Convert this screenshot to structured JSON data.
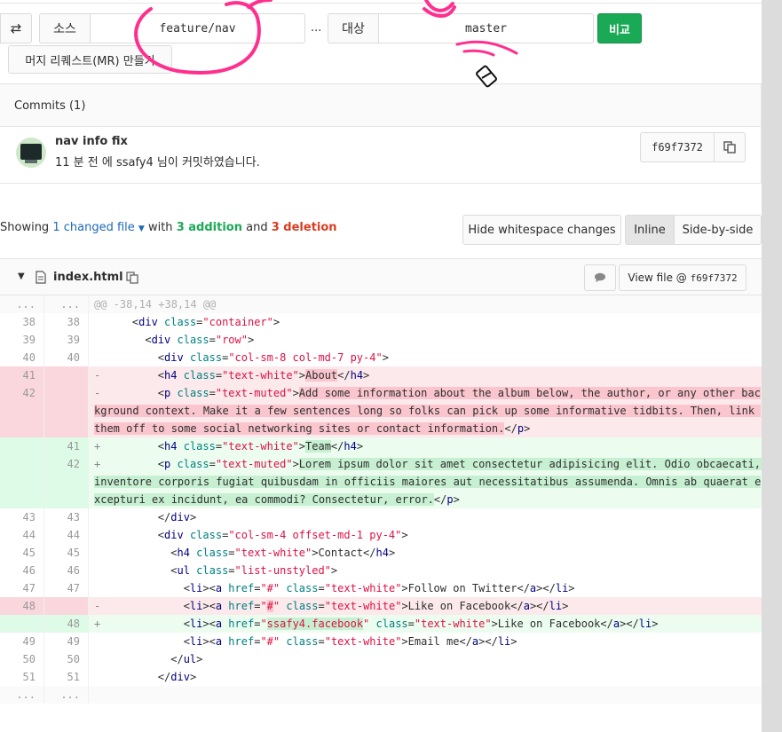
{
  "compare_bar": {
    "swap_icon": "swap-arrows-icon",
    "source_label": "소스",
    "source_branch": "feature/nav",
    "separator": "...",
    "target_label": "대상",
    "target_branch": "master",
    "compare_button": "비교",
    "create_mr_button": "머지 리퀘스트(MR) 만들기"
  },
  "commits": {
    "header": "Commits (1)",
    "items": [
      {
        "title": "nav info fix",
        "meta": "11 분 전 에 ssafy4 님이 커밋하였습니다.",
        "sha": "f69f7372"
      }
    ]
  },
  "summary": {
    "prefix": "Showing",
    "changed": "1 changed file",
    "with": "with",
    "additions": "3 addition",
    "and": "and",
    "deletions": "3 deletion",
    "hide_whitespace": "Hide whitespace changes",
    "inline": "Inline",
    "side_by_side": "Side-by-side"
  },
  "file": {
    "name": "index.html",
    "view_file": "View file @",
    "view_sha": "f69f7372",
    "hunk_header": "@@ -38,14 +38,14 @@"
  },
  "diff_rows": [
    {
      "type": "match",
      "old": "...",
      "new": "...",
      "html": "<span style=\"color:#b0b0b0\">@@ -38,14 +38,14 @@</span>"
    },
    {
      "type": "ctx",
      "old": "38",
      "new": "38",
      "html": "    &lt;<span class=\"tag\">div</span> <span class=\"attr\">class</span>=<span class=\"val\">\"container\"</span>&gt;"
    },
    {
      "type": "ctx",
      "old": "39",
      "new": "39",
      "html": "      &lt;<span class=\"tag\">div</span> <span class=\"attr\">class</span>=<span class=\"val\">\"row\"</span>&gt;"
    },
    {
      "type": "ctx",
      "old": "40",
      "new": "40",
      "html": "        &lt;<span class=\"tag\">div</span> <span class=\"attr\">class</span>=<span class=\"val\">\"col-sm-8 col-md-7 py-4\"</span>&gt;"
    },
    {
      "type": "old",
      "old": "41",
      "new": "",
      "html": "<span class=\"sign\">-</span>        &lt;<span class=\"tag\">h4</span> <span class=\"attr\">class</span>=<span class=\"val\">\"text-white\"</span>&gt;<span class=\"hl-old\">About</span>&lt;/<span class=\"tag\">h4</span>&gt;"
    },
    {
      "type": "old",
      "tall": true,
      "old": "42",
      "new": "",
      "html": "<span class=\"sign\">-</span>        &lt;<span class=\"tag\">p</span> <span class=\"attr\">class</span>=<span class=\"val\">\"text-muted\"</span>&gt;<span class=\"hl-old\">Add some information about the album below, the author, or any other background context. Make it a few sentences long so folks can pick up some informative tidbits. Then, link them off to some social networking sites or contact information.</span>&lt;/<span class=\"tag\">p</span>&gt;"
    },
    {
      "type": "new",
      "old": "",
      "new": "41",
      "html": "<span class=\"sign\">+</span>        &lt;<span class=\"tag\">h4</span> <span class=\"attr\">class</span>=<span class=\"val\">\"text-white\"</span>&gt;<span class=\"hl-new\">Team</span>&lt;/<span class=\"tag\">h4</span>&gt;"
    },
    {
      "type": "new",
      "tall": true,
      "old": "",
      "new": "42",
      "html": "<span class=\"sign\">+</span>        &lt;<span class=\"tag\">p</span> <span class=\"attr\">class</span>=<span class=\"val\">\"text-muted\"</span>&gt;<span class=\"hl-new\">Lorem ipsum dolor sit amet consectetur adipisicing elit. Odio obcaecati, inventore corporis fugiat quibusdam in officiis maiores aut necessitatibus assumenda. Omnis ab quaerat excepturi ex incidunt, ea commodi? Consectetur, error.</span>&lt;/<span class=\"tag\">p</span>&gt;"
    },
    {
      "type": "ctx",
      "old": "43",
      "new": "43",
      "html": "        &lt;/<span class=\"tag\">div</span>&gt;"
    },
    {
      "type": "ctx",
      "old": "44",
      "new": "44",
      "html": "        &lt;<span class=\"tag\">div</span> <span class=\"attr\">class</span>=<span class=\"val\">\"col-sm-4 offset-md-1 py-4\"</span>&gt;"
    },
    {
      "type": "ctx",
      "old": "45",
      "new": "45",
      "html": "          &lt;<span class=\"tag\">h4</span> <span class=\"attr\">class</span>=<span class=\"val\">\"text-white\"</span>&gt;Contact&lt;/<span class=\"tag\">h4</span>&gt;"
    },
    {
      "type": "ctx",
      "old": "46",
      "new": "46",
      "html": "          &lt;<span class=\"tag\">ul</span> <span class=\"attr\">class</span>=<span class=\"val\">\"list-unstyled\"</span>&gt;"
    },
    {
      "type": "ctx",
      "old": "47",
      "new": "47",
      "html": "            &lt;<span class=\"tag\">li</span>&gt;&lt;<span class=\"tag\">a</span> <span class=\"attr\">href</span>=<span class=\"val\">\"#\"</span> <span class=\"attr\">class</span>=<span class=\"val\">\"text-white\"</span>&gt;Follow on Twitter&lt;/<span class=\"tag\">a</span>&gt;&lt;/<span class=\"tag\">li</span>&gt;"
    },
    {
      "type": "old",
      "old": "48",
      "new": "",
      "html": "<span class=\"sign\">-</span>            &lt;<span class=\"tag\">li</span>&gt;&lt;<span class=\"tag\">a</span> <span class=\"attr\">href</span>=<span class=\"val\">\"<span class=\"hl-old\">#</span>\"</span> <span class=\"attr\">class</span>=<span class=\"val\">\"text-white\"</span>&gt;Like on Facebook&lt;/<span class=\"tag\">a</span>&gt;&lt;/<span class=\"tag\">li</span>&gt;"
    },
    {
      "type": "new",
      "old": "",
      "new": "48",
      "html": "<span class=\"sign\">+</span>            &lt;<span class=\"tag\">li</span>&gt;&lt;<span class=\"tag\">a</span> <span class=\"attr\">href</span>=<span class=\"val\">\"<span class=\"hl-new\">ssafy4.facebook</span>\"</span> <span class=\"attr\">class</span>=<span class=\"val\">\"text-white\"</span>&gt;Like on Facebook&lt;/<span class=\"tag\">a</span>&gt;&lt;/<span class=\"tag\">li</span>&gt;"
    },
    {
      "type": "ctx",
      "old": "49",
      "new": "49",
      "html": "            &lt;<span class=\"tag\">li</span>&gt;&lt;<span class=\"tag\">a</span> <span class=\"attr\">href</span>=<span class=\"val\">\"#\"</span> <span class=\"attr\">class</span>=<span class=\"val\">\"text-white\"</span>&gt;Email me&lt;/<span class=\"tag\">a</span>&gt;&lt;/<span class=\"tag\">li</span>&gt;"
    },
    {
      "type": "ctx",
      "old": "50",
      "new": "50",
      "html": "          &lt;/<span class=\"tag\">ul</span>&gt;"
    },
    {
      "type": "ctx",
      "old": "51",
      "new": "51",
      "html": "        &lt;/<span class=\"tag\">div</span>&gt;"
    },
    {
      "type": "match",
      "old": "...",
      "new": "...",
      "html": ""
    }
  ],
  "colors": {
    "compare_button": "#1aaa55",
    "added_count": "#1aaa55",
    "deleted_count": "#db3b21",
    "link": "#1b69b6",
    "annotation_pen": "#ff2f8e"
  }
}
